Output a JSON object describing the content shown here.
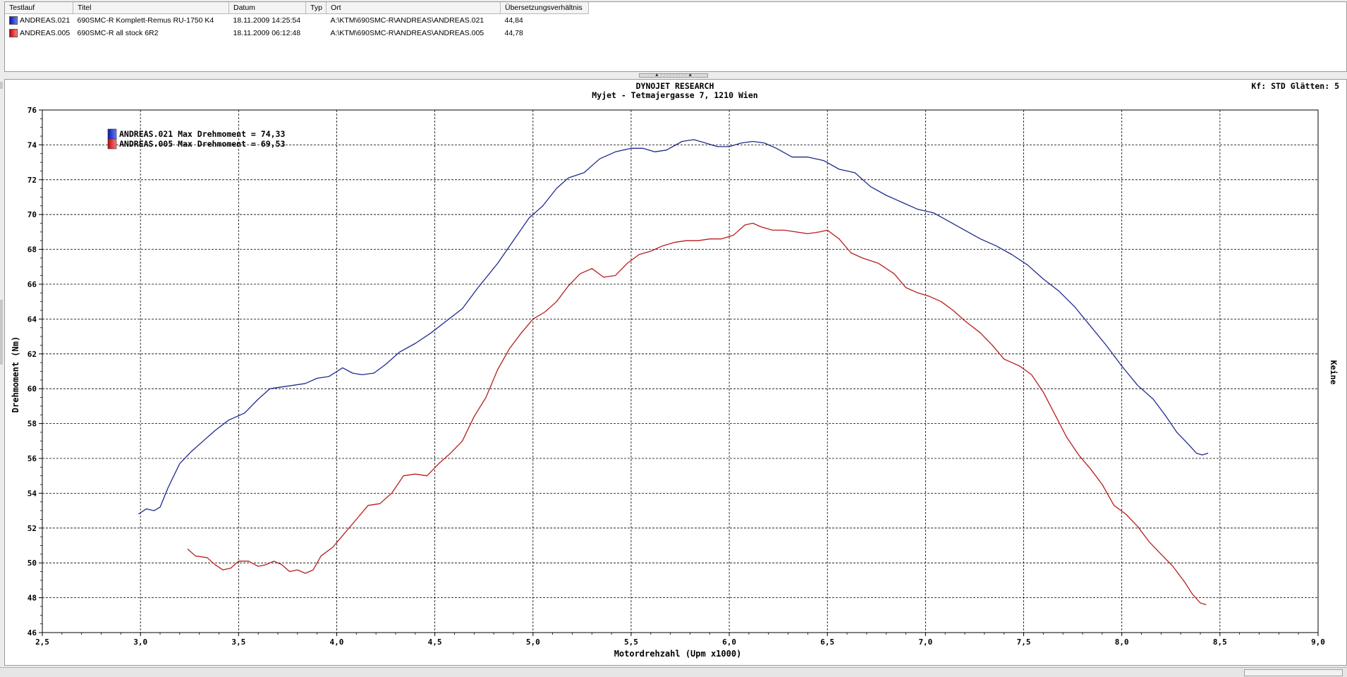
{
  "run_table": {
    "headers": [
      "Testlauf",
      "Titel",
      "Datum",
      "Typ",
      "Ort",
      "Übersetzungsverhältnis"
    ],
    "rows": [
      {
        "testlauf": "ANDREAS.021",
        "titel": "690SMC-R Komplett-Remus RU-1750 K4",
        "datum": "18.11.2009 14:25:54",
        "typ": "",
        "ort": "A:\\KTM\\690SMC-R\\ANDREAS\\ANDREAS.021",
        "ratio": "44,84",
        "color": "#1f2fd0"
      },
      {
        "testlauf": "ANDREAS.005",
        "titel": "690SMC-R all stock 6R2",
        "datum": "18.11.2009 06:12:48",
        "typ": "",
        "ort": "A:\\KTM\\690SMC-R\\ANDREAS\\ANDREAS.005",
        "ratio": "44,78",
        "color": "#d41f1f"
      }
    ]
  },
  "corner_info": "Kf: STD  Glätten: 5",
  "right_label": "Keine",
  "chart_data": {
    "type": "line",
    "title": "DYNOJET RESEARCH",
    "subtitle": "Myjet - Tetmajergasse 7, 1210 Wien",
    "xlabel": "Motordrehzahl (Upm x1000)",
    "ylabel": "Drehmoment (Nm)",
    "xlim": [
      2.5,
      9.0
    ],
    "ylim": [
      46,
      76
    ],
    "x_ticks": [
      "2,5",
      "3,0",
      "3,5",
      "4,0",
      "4,5",
      "5,0",
      "5,5",
      "6,0",
      "6,5",
      "7,0",
      "7,5",
      "8,0",
      "8,5",
      "9,0"
    ],
    "y_ticks": [
      "46",
      "48",
      "50",
      "52",
      "54",
      "56",
      "58",
      "60",
      "62",
      "64",
      "66",
      "68",
      "70",
      "72",
      "74",
      "76"
    ],
    "grid": true,
    "legend_position": "top-left",
    "series": [
      {
        "name": "ANDREAS.021 Max Drehmoment = 74,33",
        "color": "#1e2a8c",
        "points": [
          [
            2.99,
            52.8
          ],
          [
            3.03,
            53.1
          ],
          [
            3.07,
            53.0
          ],
          [
            3.1,
            53.2
          ],
          [
            3.14,
            54.3
          ],
          [
            3.2,
            55.7
          ],
          [
            3.26,
            56.4
          ],
          [
            3.32,
            57.0
          ],
          [
            3.38,
            57.6
          ],
          [
            3.45,
            58.2
          ],
          [
            3.53,
            58.6
          ],
          [
            3.6,
            59.4
          ],
          [
            3.66,
            60.0
          ],
          [
            3.72,
            60.1
          ],
          [
            3.78,
            60.2
          ],
          [
            3.84,
            60.3
          ],
          [
            3.9,
            60.6
          ],
          [
            3.96,
            60.7
          ],
          [
            4.03,
            61.2
          ],
          [
            4.08,
            60.9
          ],
          [
            4.13,
            60.8
          ],
          [
            4.19,
            60.9
          ],
          [
            4.25,
            61.4
          ],
          [
            4.32,
            62.1
          ],
          [
            4.4,
            62.6
          ],
          [
            4.48,
            63.2
          ],
          [
            4.56,
            63.9
          ],
          [
            4.64,
            64.6
          ],
          [
            4.72,
            65.8
          ],
          [
            4.82,
            67.2
          ],
          [
            4.9,
            68.5
          ],
          [
            4.98,
            69.8
          ],
          [
            5.05,
            70.5
          ],
          [
            5.12,
            71.5
          ],
          [
            5.18,
            72.1
          ],
          [
            5.26,
            72.4
          ],
          [
            5.34,
            73.2
          ],
          [
            5.42,
            73.6
          ],
          [
            5.5,
            73.8
          ],
          [
            5.56,
            73.8
          ],
          [
            5.62,
            73.6
          ],
          [
            5.68,
            73.7
          ],
          [
            5.76,
            74.2
          ],
          [
            5.82,
            74.3
          ],
          [
            5.88,
            74.1
          ],
          [
            5.94,
            73.9
          ],
          [
            6.0,
            73.9
          ],
          [
            6.06,
            74.1
          ],
          [
            6.12,
            74.2
          ],
          [
            6.18,
            74.1
          ],
          [
            6.24,
            73.8
          ],
          [
            6.32,
            73.3
          ],
          [
            6.4,
            73.3
          ],
          [
            6.48,
            73.1
          ],
          [
            6.56,
            72.6
          ],
          [
            6.64,
            72.4
          ],
          [
            6.72,
            71.6
          ],
          [
            6.8,
            71.1
          ],
          [
            6.88,
            70.7
          ],
          [
            6.96,
            70.3
          ],
          [
            7.04,
            70.1
          ],
          [
            7.12,
            69.6
          ],
          [
            7.2,
            69.1
          ],
          [
            7.28,
            68.6
          ],
          [
            7.36,
            68.2
          ],
          [
            7.44,
            67.7
          ],
          [
            7.52,
            67.1
          ],
          [
            7.6,
            66.3
          ],
          [
            7.68,
            65.6
          ],
          [
            7.76,
            64.7
          ],
          [
            7.84,
            63.6
          ],
          [
            7.92,
            62.5
          ],
          [
            8.0,
            61.3
          ],
          [
            8.08,
            60.2
          ],
          [
            8.16,
            59.4
          ],
          [
            8.22,
            58.5
          ],
          [
            8.28,
            57.5
          ],
          [
            8.34,
            56.8
          ],
          [
            8.38,
            56.3
          ],
          [
            8.41,
            56.2
          ],
          [
            8.44,
            56.3
          ]
        ]
      },
      {
        "name": "ANDREAS.005 Max Drehmoment = 69,53",
        "color": "#b81d1d",
        "points": [
          [
            3.24,
            50.8
          ],
          [
            3.28,
            50.4
          ],
          [
            3.34,
            50.3
          ],
          [
            3.38,
            49.9
          ],
          [
            3.42,
            49.6
          ],
          [
            3.46,
            49.7
          ],
          [
            3.5,
            50.1
          ],
          [
            3.55,
            50.1
          ],
          [
            3.6,
            49.8
          ],
          [
            3.64,
            49.9
          ],
          [
            3.68,
            50.1
          ],
          [
            3.72,
            49.9
          ],
          [
            3.76,
            49.5
          ],
          [
            3.8,
            49.6
          ],
          [
            3.84,
            49.4
          ],
          [
            3.88,
            49.6
          ],
          [
            3.92,
            50.4
          ],
          [
            3.98,
            50.9
          ],
          [
            4.04,
            51.7
          ],
          [
            4.1,
            52.5
          ],
          [
            4.16,
            53.3
          ],
          [
            4.22,
            53.4
          ],
          [
            4.28,
            54.0
          ],
          [
            4.34,
            55.0
          ],
          [
            4.4,
            55.1
          ],
          [
            4.46,
            55.0
          ],
          [
            4.52,
            55.7
          ],
          [
            4.58,
            56.3
          ],
          [
            4.64,
            57.0
          ],
          [
            4.7,
            58.4
          ],
          [
            4.76,
            59.5
          ],
          [
            4.82,
            61.1
          ],
          [
            4.88,
            62.3
          ],
          [
            4.94,
            63.2
          ],
          [
            5.0,
            64.0
          ],
          [
            5.06,
            64.4
          ],
          [
            5.12,
            65.0
          ],
          [
            5.18,
            65.9
          ],
          [
            5.24,
            66.6
          ],
          [
            5.3,
            66.9
          ],
          [
            5.36,
            66.4
          ],
          [
            5.42,
            66.5
          ],
          [
            5.48,
            67.2
          ],
          [
            5.54,
            67.7
          ],
          [
            5.6,
            67.9
          ],
          [
            5.66,
            68.2
          ],
          [
            5.72,
            68.4
          ],
          [
            5.78,
            68.5
          ],
          [
            5.84,
            68.5
          ],
          [
            5.9,
            68.6
          ],
          [
            5.96,
            68.6
          ],
          [
            6.02,
            68.8
          ],
          [
            6.08,
            69.4
          ],
          [
            6.12,
            69.5
          ],
          [
            6.16,
            69.3
          ],
          [
            6.22,
            69.1
          ],
          [
            6.28,
            69.1
          ],
          [
            6.34,
            69.0
          ],
          [
            6.4,
            68.9
          ],
          [
            6.46,
            69.0
          ],
          [
            6.5,
            69.1
          ],
          [
            6.56,
            68.6
          ],
          [
            6.62,
            67.8
          ],
          [
            6.68,
            67.5
          ],
          [
            6.76,
            67.2
          ],
          [
            6.84,
            66.6
          ],
          [
            6.9,
            65.8
          ],
          [
            6.96,
            65.5
          ],
          [
            7.02,
            65.3
          ],
          [
            7.08,
            65.0
          ],
          [
            7.14,
            64.5
          ],
          [
            7.2,
            63.9
          ],
          [
            7.28,
            63.2
          ],
          [
            7.34,
            62.5
          ],
          [
            7.4,
            61.7
          ],
          [
            7.48,
            61.3
          ],
          [
            7.54,
            60.8
          ],
          [
            7.6,
            59.8
          ],
          [
            7.66,
            58.5
          ],
          [
            7.72,
            57.2
          ],
          [
            7.78,
            56.2
          ],
          [
            7.84,
            55.4
          ],
          [
            7.9,
            54.5
          ],
          [
            7.96,
            53.3
          ],
          [
            8.02,
            52.8
          ],
          [
            8.08,
            52.1
          ],
          [
            8.14,
            51.2
          ],
          [
            8.2,
            50.5
          ],
          [
            8.26,
            49.8
          ],
          [
            8.32,
            48.9
          ],
          [
            8.36,
            48.2
          ],
          [
            8.4,
            47.7
          ],
          [
            8.43,
            47.6
          ]
        ]
      }
    ]
  }
}
